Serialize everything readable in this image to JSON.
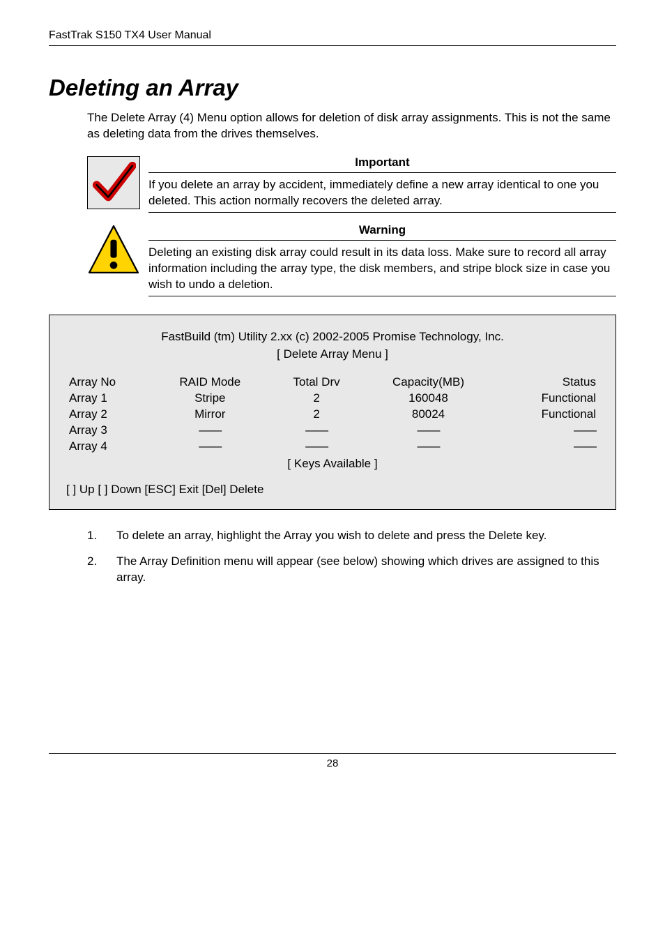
{
  "running_head": "FastTrak S150 TX4 User Manual",
  "section_title": "Deleting an Array",
  "intro": "The Delete Array (4) Menu option allows for deletion of disk array assignments. This is not the same as deleting data from the drives themselves.",
  "callouts": [
    {
      "title": "Important",
      "text": "If you delete an array by accident, immediately define a new array identical to one you deleted. This action normally recovers the deleted array.",
      "icon": "checkmark-icon"
    },
    {
      "title": "Warning",
      "text": "Deleting an existing disk array could result in its data loss. Make sure to record all array information including the array type, the disk members, and stripe block size in case you wish to undo a deletion.",
      "icon": "warning-icon"
    }
  ],
  "terminal": {
    "title": "FastBuild (tm) Utility 2.xx (c) 2002-2005 Promise Technology, Inc.",
    "subtitle": "[ Delete Array Menu ]",
    "columns": [
      "Array No",
      "RAID Mode",
      "Total Drv",
      "Capacity(MB)",
      "Status"
    ],
    "rows": [
      {
        "arr": "Array 1",
        "mode": "Stripe",
        "drv": "2",
        "cap": "160048",
        "stat": "Functional"
      },
      {
        "arr": "Array 2",
        "mode": "Mirror",
        "drv": "2",
        "cap": "80024",
        "stat": "Functional"
      },
      {
        "arr": "Array 3",
        "mode": "——",
        "drv": "——",
        "cap": "——",
        "stat": "——"
      },
      {
        "arr": "Array 4",
        "mode": "——",
        "drv": "——",
        "cap": "——",
        "stat": "——"
      }
    ],
    "keys_label": "[ Keys Available ]",
    "keyline": "[  ] Up [  ] Down     [ESC] Exit    [Del] Delete"
  },
  "steps": [
    "To delete an array, highlight the Array you wish to delete and press the Delete key.",
    "The Array Definition menu will appear (see below) showing which drives are assigned to this array."
  ],
  "page_number": "28"
}
